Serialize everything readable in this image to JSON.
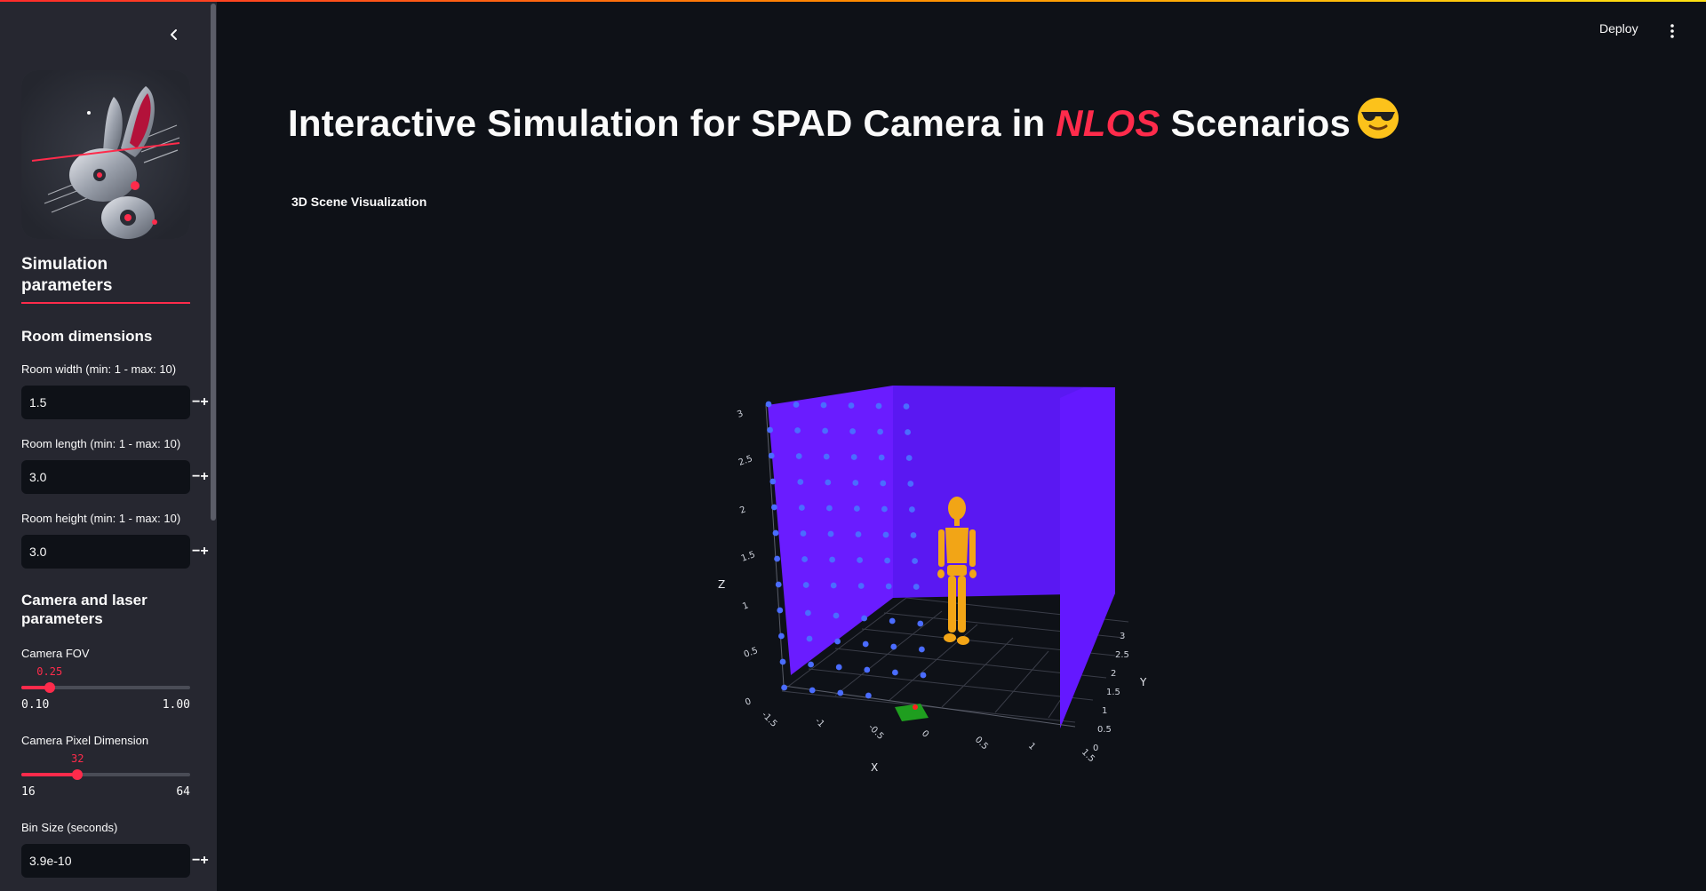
{
  "sidebar": {
    "title": "Simulation parameters",
    "room_section": "Room dimensions",
    "room_width": {
      "label": "Room width (min: 1 - max: 10)",
      "value": "1.5"
    },
    "room_length": {
      "label": "Room length (min: 1 - max: 10)",
      "value": "3.0"
    },
    "room_height": {
      "label": "Room height (min: 1 - max: 10)",
      "value": "3.0"
    },
    "camera_section": "Camera and laser parameters",
    "camera_fov": {
      "label": "Camera FOV",
      "value": "0.25",
      "min": "0.10",
      "max": "1.00",
      "fraction": 0.167
    },
    "camera_pixel": {
      "label": "Camera Pixel Dimension",
      "value": "32",
      "min": "16",
      "max": "64",
      "fraction": 0.333
    },
    "bin_size": {
      "label": "Bin Size (seconds)",
      "value": "3.9e-10"
    },
    "minus_symbol": "−",
    "plus_symbol": "+"
  },
  "header": {
    "deploy_label": "Deploy",
    "menu_icon": "more-vertical-icon"
  },
  "main": {
    "title_pre": "Interactive Simulation for SPAD Camera in ",
    "title_highlight": "NLOS",
    "title_post": " Scenarios",
    "title_emoji": "sunglasses-face",
    "accent_color": "#ff2b4b",
    "subheading": "3D Scene Visualization"
  },
  "scene": {
    "wall_color": "#6a1cff",
    "dot_color": "#4a6cff",
    "figure_color": "#f2a516",
    "sensor_color": "#1f9e1f",
    "laser_color": "#ff2020",
    "x_label": "X",
    "y_label": "Y",
    "z_label": "Z",
    "x_ticks": [
      "-1.5",
      "-1",
      "-0.5",
      "0",
      "0.5",
      "1",
      "1.5"
    ],
    "y_ticks": [
      "0",
      "0.5",
      "1",
      "1.5",
      "2",
      "2.5",
      "3"
    ],
    "z_ticks": [
      "0",
      "0.5",
      "1",
      "1.5",
      "2",
      "2.5",
      "3"
    ]
  }
}
